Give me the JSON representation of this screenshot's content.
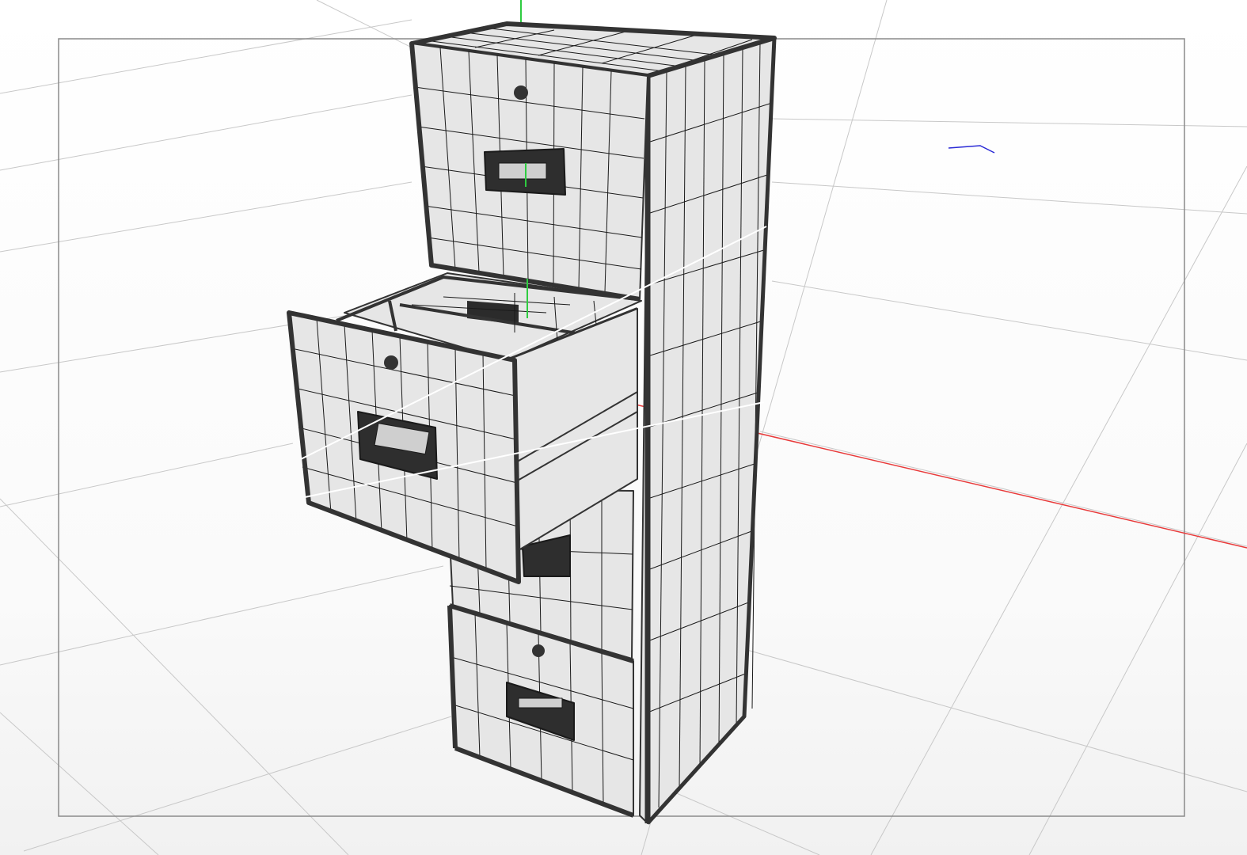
{
  "viewport": {
    "background": "#ffffff",
    "grid_color": "#c8c8c8",
    "render_frame_color": "#8a8a8a"
  },
  "axes": {
    "x_axis_color": "#e83a3a",
    "y_axis_color": "#2ecc40",
    "z_axis_color": "#2a2ad6"
  },
  "model": {
    "object": "filing-cabinet",
    "display_mode": "wireframe-on-shaded",
    "face_color": "#e6e6e6",
    "wire_color": "#1a1a1a",
    "edge_color": "#333333",
    "drawer_count": 4,
    "open_drawer_index": 2,
    "selection_outline_color": "#ffffff"
  }
}
